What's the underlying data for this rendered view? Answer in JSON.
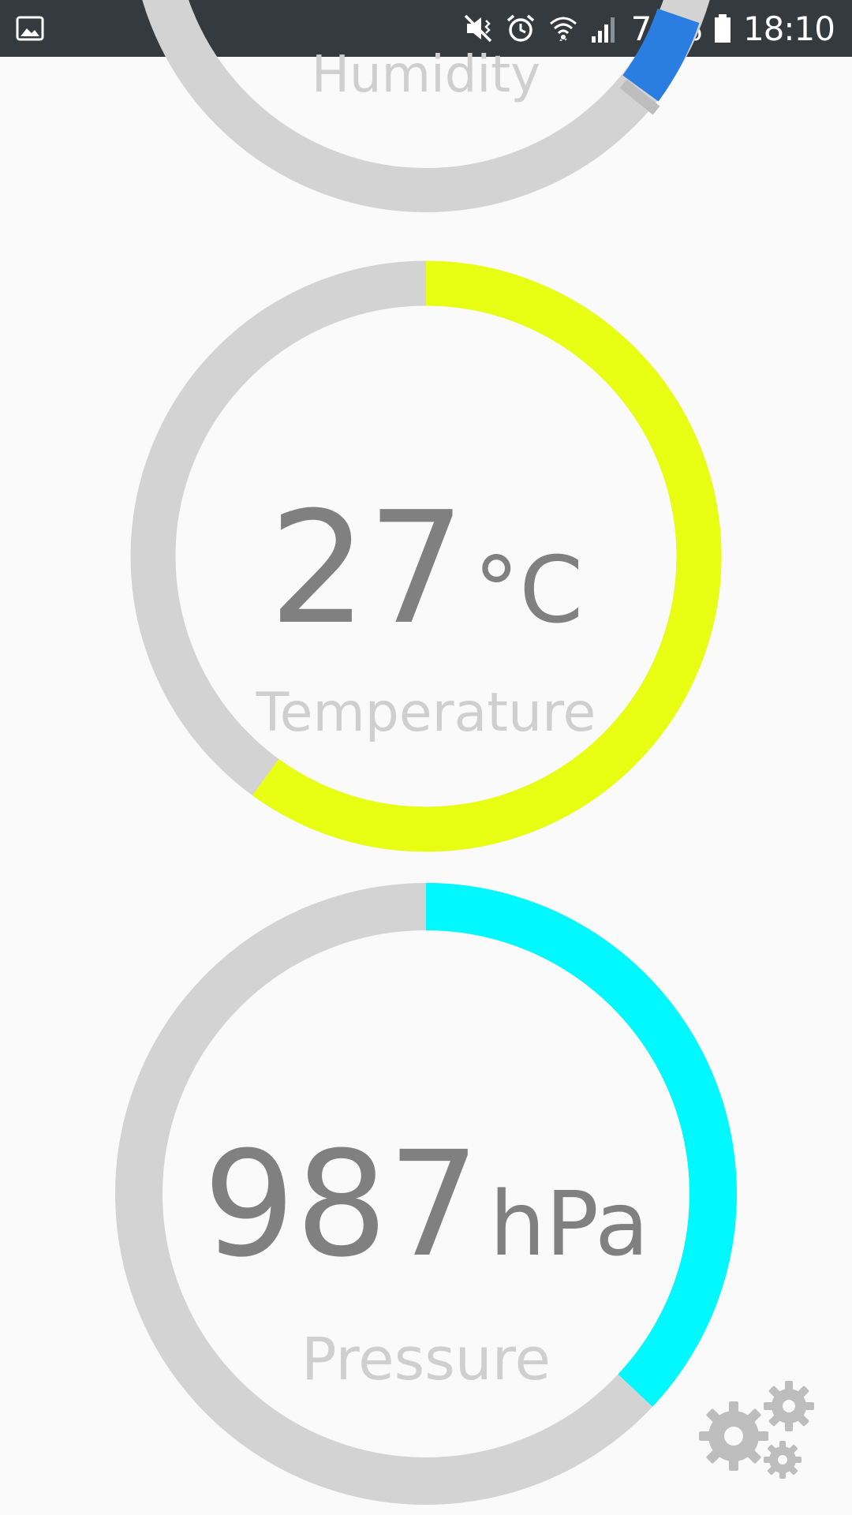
{
  "status_bar": {
    "battery_percent": "73%",
    "time": "18:10",
    "icons": [
      "gallery-icon",
      "vibrate-mute-icon",
      "alarm-icon",
      "wifi-icon",
      "signal-icon",
      "battery-icon"
    ]
  },
  "colors": {
    "track": "#d3d3d3",
    "humidity_accent": "#2a7de1",
    "temperature_accent": "#e8ff14",
    "pressure_accent": "#00f8ff",
    "value_text": "#808080",
    "label_text": "#cfcfcf",
    "gear": "#bdbdbd"
  },
  "gauges": {
    "humidity": {
      "label": "Humidity"
    },
    "temperature": {
      "value": "27",
      "unit": "°C",
      "label": "Temperature",
      "fill_fraction": 0.6
    },
    "pressure": {
      "value": "987",
      "unit": "hPa",
      "label": "Pressure",
      "fill_fraction": 0.37
    }
  },
  "settings": {
    "icon": "gears-icon"
  }
}
